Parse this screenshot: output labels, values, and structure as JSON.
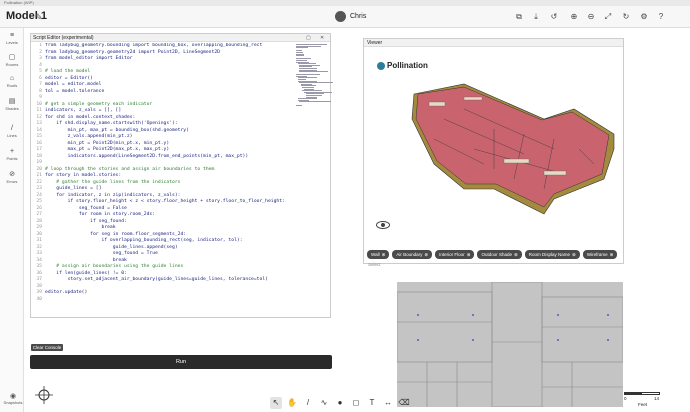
{
  "titlebar": "Pollination (WIP)",
  "header": {
    "title": "Model 1",
    "user": "Chris",
    "icons": [
      "menu-icon",
      "copy-icon",
      "download-icon",
      "undo-icon",
      "zoom-in-icon",
      "zoom-out-icon",
      "zoom-extents-icon",
      "redo-icon",
      "settings-icon",
      "help-icon"
    ]
  },
  "sidebar": {
    "items": [
      {
        "label": "Levels",
        "icon": "≡"
      },
      {
        "label": "Rooms",
        "icon": "▢"
      },
      {
        "label": "Roofs",
        "icon": "⌂"
      },
      {
        "label": "Shades",
        "icon": "▤"
      },
      {
        "label": "Lines",
        "icon": "/"
      },
      {
        "label": "Points",
        "icon": "+"
      },
      {
        "label": "Errors",
        "icon": "⊘"
      }
    ],
    "bottom": "Snapshots"
  },
  "editor": {
    "title": "Script Editor (experimental)",
    "lines": [
      "from ladybug_geometry.bounding import bounding_box, overlapping_bounding_rect",
      "from ladybug_geometry.geometry2d import Point2D, LineSegment2D",
      "from model_editor import Editor",
      "",
      "# load the model",
      "editor = Editor()",
      "model = editor.model",
      "tol = model.tolerance",
      "",
      "# get a simple geometry each indicator",
      "indicators, z_vals = [], []",
      "for shd in model.context_shades:",
      "    if shd.display_name.startswith('Openings'):",
      "        min_pt, max_pt = bounding_box(shd.geometry)",
      "        z_vals.append(min_pt.z)",
      "        min_pt = Point2D(min_pt.x, min_pt.y)",
      "        max_pt = Point2D(max_pt.x, max_pt.y)",
      "        indicators.append(LineSegment2D.from_end_points(min_pt, max_pt))",
      "",
      "# loop through the stories and assign air boundaries to them",
      "for story in model.stories:",
      "    # gather the guide lines from the indicators",
      "    guide_lines = []",
      "    for indicator, z in zip(indicators, z_vals):",
      "        if story.floor_height < z < story.floor_height + story.floor_to_floor_height:",
      "            seg_found = False",
      "            for room in story.room_2ds:",
      "                if seg_found:",
      "                    break",
      "                for seg in room.floor_segments_2d:",
      "                    if overlapping_bounding_rect(seg, indicator, tol):",
      "                        guide_lines.append(seg)",
      "                        seg_found = True",
      "                        break",
      "    # assign air boundaries using the guide lines",
      "    if len(guide_lines) != 0:",
      "        story.set_adjacent_air_boundary(guide_lines=guide_lines, tolerance=tol)",
      "",
      "editor.update()",
      ""
    ],
    "clear_label": "Clear Console",
    "run_label": "Run"
  },
  "viewer": {
    "title": "Viewer",
    "brand": "Pollination",
    "chips": [
      "Wall",
      "Air Boundary",
      "Interior Floor",
      "Outdoor Shade",
      "Room Display Name",
      "Wireframe"
    ],
    "select_label": "Select"
  },
  "scale": {
    "zero": "0",
    "max": "14",
    "unit": "Feet"
  },
  "colors": {
    "accent": "#2a2a2a",
    "room_fill": "#c9646e",
    "wall": "#a48a3e",
    "code_text": "#1a237e"
  }
}
